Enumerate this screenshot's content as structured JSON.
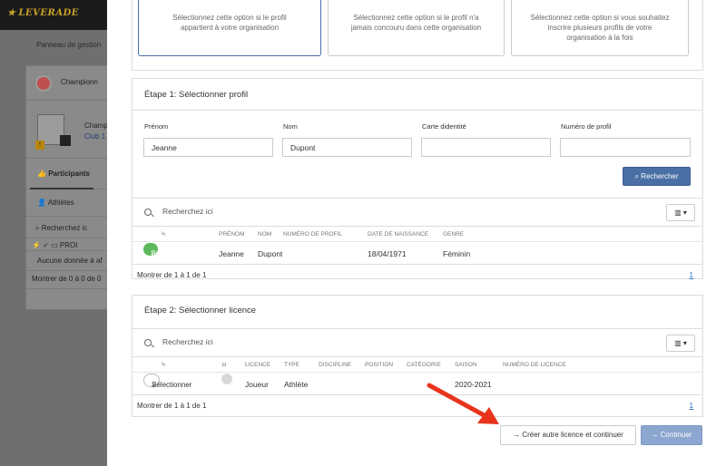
{
  "background": {
    "logo": "LEVERADE",
    "breadcrumb": "Panneau de gestion",
    "championship": "Championn",
    "club_name": "Champ",
    "club_sub": "Club 1",
    "badge": "!",
    "tab_participants": "Participants",
    "tab_athletes": "Athlètes",
    "search_placeholder": "Recherchez ic",
    "thead_short": "PROI",
    "empty_text": "Aucune donnée à af",
    "footer_text": "Montrer de 0 à 0 de 0"
  },
  "options": [
    {
      "text_1": "Sélectionnez cette option si le profil",
      "text_2": "appartient à votre organisation",
      "text_3": ""
    },
    {
      "text_1": "Sélectionnez cette option si le profil n'a",
      "text_2": "jamais concouru dans cette organisation",
      "text_3": ""
    },
    {
      "text_1": "Sélectionnez cette option si vous souhaitez",
      "text_2": "inscrire plusieurs profils de votre",
      "text_3": "organisation à la fois"
    }
  ],
  "step1": {
    "title": "Étape 1: Sélectionner profil",
    "labels": {
      "first_name": "Prénom",
      "last_name": "Nom",
      "id_card": "Carte didentité",
      "profile_number": "Numéro de profil"
    },
    "values": {
      "first_name": "Jeanne",
      "last_name": "Dupont",
      "id_card": "",
      "profile_number": ""
    },
    "search_button": "Rechercher",
    "table_search_placeholder": "Recherchez ici",
    "columns": [
      "PRÉNOM",
      "NOM",
      "NUMÉRO DE PROFIL",
      "DATE DE NAISSANCE",
      "GENRE"
    ],
    "row": {
      "status": "Sélectionné",
      "first_name": "Jeanne",
      "last_name": "Dupont",
      "profile_number": "",
      "birth_date": "18/04/1971",
      "gender": "Féminin"
    },
    "footer": "Montrer de 1 à 1 de 1",
    "page": "1"
  },
  "step2": {
    "title": "Étape 2: Sélectionner licence",
    "table_search_placeholder": "Recherchez ici",
    "columns": [
      "LICENCE",
      "TYPE",
      "DISCIPLINE",
      "POSITION",
      "CATÉGORIE",
      "SAISON",
      "NUMÉRO DE LICENCE"
    ],
    "row": {
      "action": "Sélectionner",
      "licence": "Joueur",
      "type": "Athlète",
      "discipline": "",
      "position": "",
      "category": "",
      "season": "2020-2021",
      "licence_number": ""
    },
    "footer": "Montrer de 1 à 1 de 1",
    "page": "1"
  },
  "actions": {
    "create_another": "Créer autre licence et continuer",
    "continue": "Continuer"
  },
  "colors": {
    "primary": "#4a6fa5",
    "success": "#5cb85c",
    "arrow": "#e8341c"
  },
  "icons": [
    "star-icon",
    "search-icon",
    "columns-icon",
    "caret-down-icon",
    "arrow-right-icon",
    "check-icon",
    "lightning-icon",
    "camera-icon",
    "thumbs-up-icon",
    "user-icon",
    "avatar-icon"
  ]
}
